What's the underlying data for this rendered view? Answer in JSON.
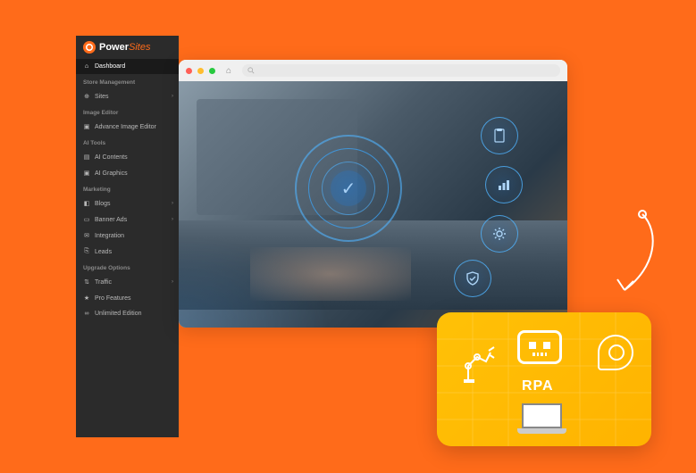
{
  "logo": {
    "text": "Power",
    "accent": "Sites"
  },
  "sidebar": {
    "dashboard": "Dashboard",
    "sections": [
      {
        "header": "Store Management",
        "items": [
          {
            "icon": "globe",
            "label": "Sites",
            "hasSub": true
          }
        ]
      },
      {
        "header": "Image Editor",
        "items": [
          {
            "icon": "image",
            "label": "Advance Image Editor"
          }
        ]
      },
      {
        "header": "AI Tools",
        "items": [
          {
            "icon": "file",
            "label": "AI Contents"
          },
          {
            "icon": "image",
            "label": "AI Graphics"
          }
        ]
      },
      {
        "header": "Marketing",
        "items": [
          {
            "icon": "blog",
            "label": "Blogs",
            "hasSub": true
          },
          {
            "icon": "ad",
            "label": "Banner Ads",
            "hasSub": true
          },
          {
            "icon": "mail",
            "label": "Integration"
          },
          {
            "icon": "leads",
            "label": "Leads"
          }
        ]
      },
      {
        "header": "Upgrade Options",
        "items": [
          {
            "icon": "traffic",
            "label": "Traffic",
            "hasSub": true
          },
          {
            "icon": "star",
            "label": "Pro Features"
          },
          {
            "icon": "infinity",
            "label": "Unlimited Edition"
          }
        ]
      }
    ]
  },
  "browser": {
    "searchPlaceholder": ""
  },
  "rpa": {
    "label": "RPA"
  },
  "icons": {
    "globe": "⊕",
    "image": "▣",
    "file": "▤",
    "blog": "◧",
    "ad": "▭",
    "mail": "✉",
    "leads": "⎘",
    "traffic": "⇅",
    "star": "★",
    "infinity": "∞",
    "home": "⌂"
  }
}
